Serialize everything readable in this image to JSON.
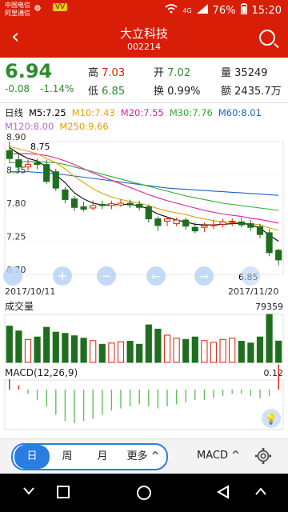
{
  "status_bar": {
    "carrier1": "中国电信",
    "carrier2": "阿里通信",
    "signal_type": "4G",
    "battery": "76%",
    "time": "15:20",
    "badge": "VV"
  },
  "header": {
    "title": "大立科技",
    "code": "002214"
  },
  "quote": {
    "price": "6.94",
    "change": "-0.08",
    "change_pct": "-1.14%",
    "high_label": "高",
    "high": "7.03",
    "low_label": "低",
    "low": "6.85",
    "open_label": "开",
    "open": "7.02",
    "turnover_label": "换",
    "turnover": "0.99%",
    "volume_label": "量",
    "volume": "35249",
    "amount_label": "额",
    "amount": "2435.7万"
  },
  "ma": {
    "period": "日线",
    "m5": "M5:7.25",
    "m10": "M10:7.43",
    "m20": "M20:7.55",
    "m30": "M30:7.76",
    "m60": "M60:8.01",
    "m120": "M120:8.00",
    "m250": "M250:9.66"
  },
  "colors": {
    "m5": "#000000",
    "m10": "#e6a000",
    "m20": "#e0209a",
    "m30": "#2eaf2e",
    "m60": "#1f62c8",
    "m120": "#b070c0",
    "m250": "#e0a000",
    "up": "#d81e06",
    "down": "#1f6e1f"
  },
  "chart": {
    "max_label": "8.75",
    "min_label": "6.85",
    "y_labels": [
      "8.90",
      "8.35",
      "7.80",
      "7.25",
      "6.70"
    ],
    "date_start": "2017/10/11",
    "date_end": "2017/11/20",
    "volume_title": "成交量",
    "volume_max": "79359",
    "macd_title": "MACD(12,26,9)",
    "macd_value": "0.12"
  },
  "chart_data": {
    "type": "candlestick",
    "x": [
      "2017/10/11",
      "",
      "",
      "",
      "",
      "",
      "",
      "",
      "",
      "",
      "",
      "",
      "",
      "",
      "",
      "",
      "",
      "",
      "",
      "",
      "",
      "",
      "",
      "",
      "",
      "",
      "",
      "",
      "",
      "2017/11/20"
    ],
    "open": [
      8.75,
      8.6,
      8.48,
      8.55,
      8.52,
      8.4,
      8.1,
      7.95,
      7.82,
      7.8,
      7.86,
      7.84,
      7.85,
      7.88,
      7.86,
      7.82,
      7.62,
      7.58,
      7.54,
      7.6,
      7.48,
      7.48,
      7.51,
      7.53,
      7.57,
      7.57,
      7.54,
      7.49,
      7.39,
      7.1
    ],
    "close": [
      8.62,
      8.48,
      8.52,
      8.52,
      8.24,
      8.13,
      7.94,
      7.81,
      7.78,
      7.84,
      7.84,
      7.87,
      7.88,
      7.85,
      7.81,
      7.62,
      7.51,
      7.62,
      7.6,
      7.5,
      7.42,
      7.51,
      7.52,
      7.57,
      7.58,
      7.52,
      7.48,
      7.36,
      7.06,
      6.94
    ],
    "high": [
      8.9,
      8.72,
      8.6,
      8.62,
      8.6,
      8.45,
      8.15,
      8.0,
      7.9,
      7.92,
      7.92,
      7.92,
      7.94,
      7.94,
      7.92,
      7.86,
      7.66,
      7.66,
      7.64,
      7.64,
      7.56,
      7.56,
      7.6,
      7.62,
      7.63,
      7.64,
      7.6,
      7.54,
      7.45,
      7.12
    ],
    "low": [
      8.55,
      8.4,
      8.42,
      8.44,
      8.2,
      8.08,
      7.88,
      7.75,
      7.74,
      7.76,
      7.78,
      7.78,
      7.82,
      7.8,
      7.76,
      7.56,
      7.42,
      7.5,
      7.5,
      7.44,
      7.38,
      7.4,
      7.45,
      7.48,
      7.5,
      7.48,
      7.42,
      7.3,
      7.0,
      6.85
    ],
    "ma5": [
      8.8,
      8.7,
      8.62,
      8.58,
      8.48,
      8.35,
      8.22,
      8.05,
      7.95,
      7.88,
      7.85,
      7.85,
      7.86,
      7.86,
      7.84,
      7.78,
      7.7,
      7.65,
      7.6,
      7.57,
      7.53,
      7.52,
      7.52,
      7.53,
      7.54,
      7.55,
      7.52,
      7.47,
      7.35,
      7.25
    ],
    "ma10": [
      8.82,
      8.78,
      8.74,
      8.7,
      8.62,
      8.55,
      8.45,
      8.32,
      8.22,
      8.12,
      8.04,
      7.98,
      7.94,
      7.91,
      7.88,
      7.84,
      7.79,
      7.75,
      7.72,
      7.69,
      7.65,
      7.62,
      7.59,
      7.57,
      7.56,
      7.55,
      7.54,
      7.52,
      7.47,
      7.43
    ],
    "ma20": [
      8.7,
      8.7,
      8.7,
      8.69,
      8.67,
      8.63,
      8.58,
      8.52,
      8.45,
      8.38,
      8.32,
      8.26,
      8.2,
      8.14,
      8.08,
      8.02,
      7.97,
      7.92,
      7.88,
      7.84,
      7.8,
      7.76,
      7.73,
      7.7,
      7.68,
      7.66,
      7.63,
      7.61,
      7.58,
      7.55
    ],
    "ma30": [
      8.55,
      8.56,
      8.57,
      8.57,
      8.56,
      8.55,
      8.52,
      8.48,
      8.44,
      8.4,
      8.36,
      8.32,
      8.28,
      8.24,
      8.2,
      8.16,
      8.12,
      8.08,
      8.04,
      8.0,
      7.97,
      7.94,
      7.91,
      7.88,
      7.86,
      7.84,
      7.82,
      7.8,
      7.78,
      7.76
    ],
    "ma60": [
      8.4,
      8.4,
      8.4,
      8.39,
      8.38,
      8.37,
      8.35,
      8.33,
      8.31,
      8.29,
      8.27,
      8.25,
      8.23,
      8.21,
      8.19,
      8.17,
      8.15,
      8.13,
      8.12,
      8.11,
      8.1,
      8.09,
      8.08,
      8.07,
      8.06,
      8.05,
      8.04,
      8.03,
      8.02,
      8.01
    ],
    "volume": [
      60000,
      52000,
      38000,
      42000,
      58000,
      50000,
      48000,
      44000,
      40000,
      36000,
      30000,
      32000,
      34000,
      35000,
      30000,
      62000,
      55000,
      45000,
      40000,
      38000,
      42000,
      36000,
      33000,
      38000,
      40000,
      35000,
      32000,
      42000,
      79359,
      35249
    ],
    "macd_hist": [
      0.05,
      0.02,
      -0.02,
      -0.05,
      -0.08,
      -0.12,
      -0.15,
      -0.16,
      -0.15,
      -0.14,
      -0.12,
      -0.1,
      -0.09,
      -0.08,
      -0.07,
      -0.08,
      -0.09,
      -0.08,
      -0.07,
      -0.06,
      -0.05,
      -0.05,
      -0.04,
      -0.03,
      -0.02,
      -0.02,
      -0.03,
      -0.04,
      -0.03,
      0.12
    ],
    "xlabel": "",
    "ylabel": "",
    "ylim": [
      6.7,
      8.9
    ]
  },
  "controls": {
    "tabs": [
      "日",
      "周",
      "月",
      "更多"
    ],
    "indicator": "MACD"
  }
}
